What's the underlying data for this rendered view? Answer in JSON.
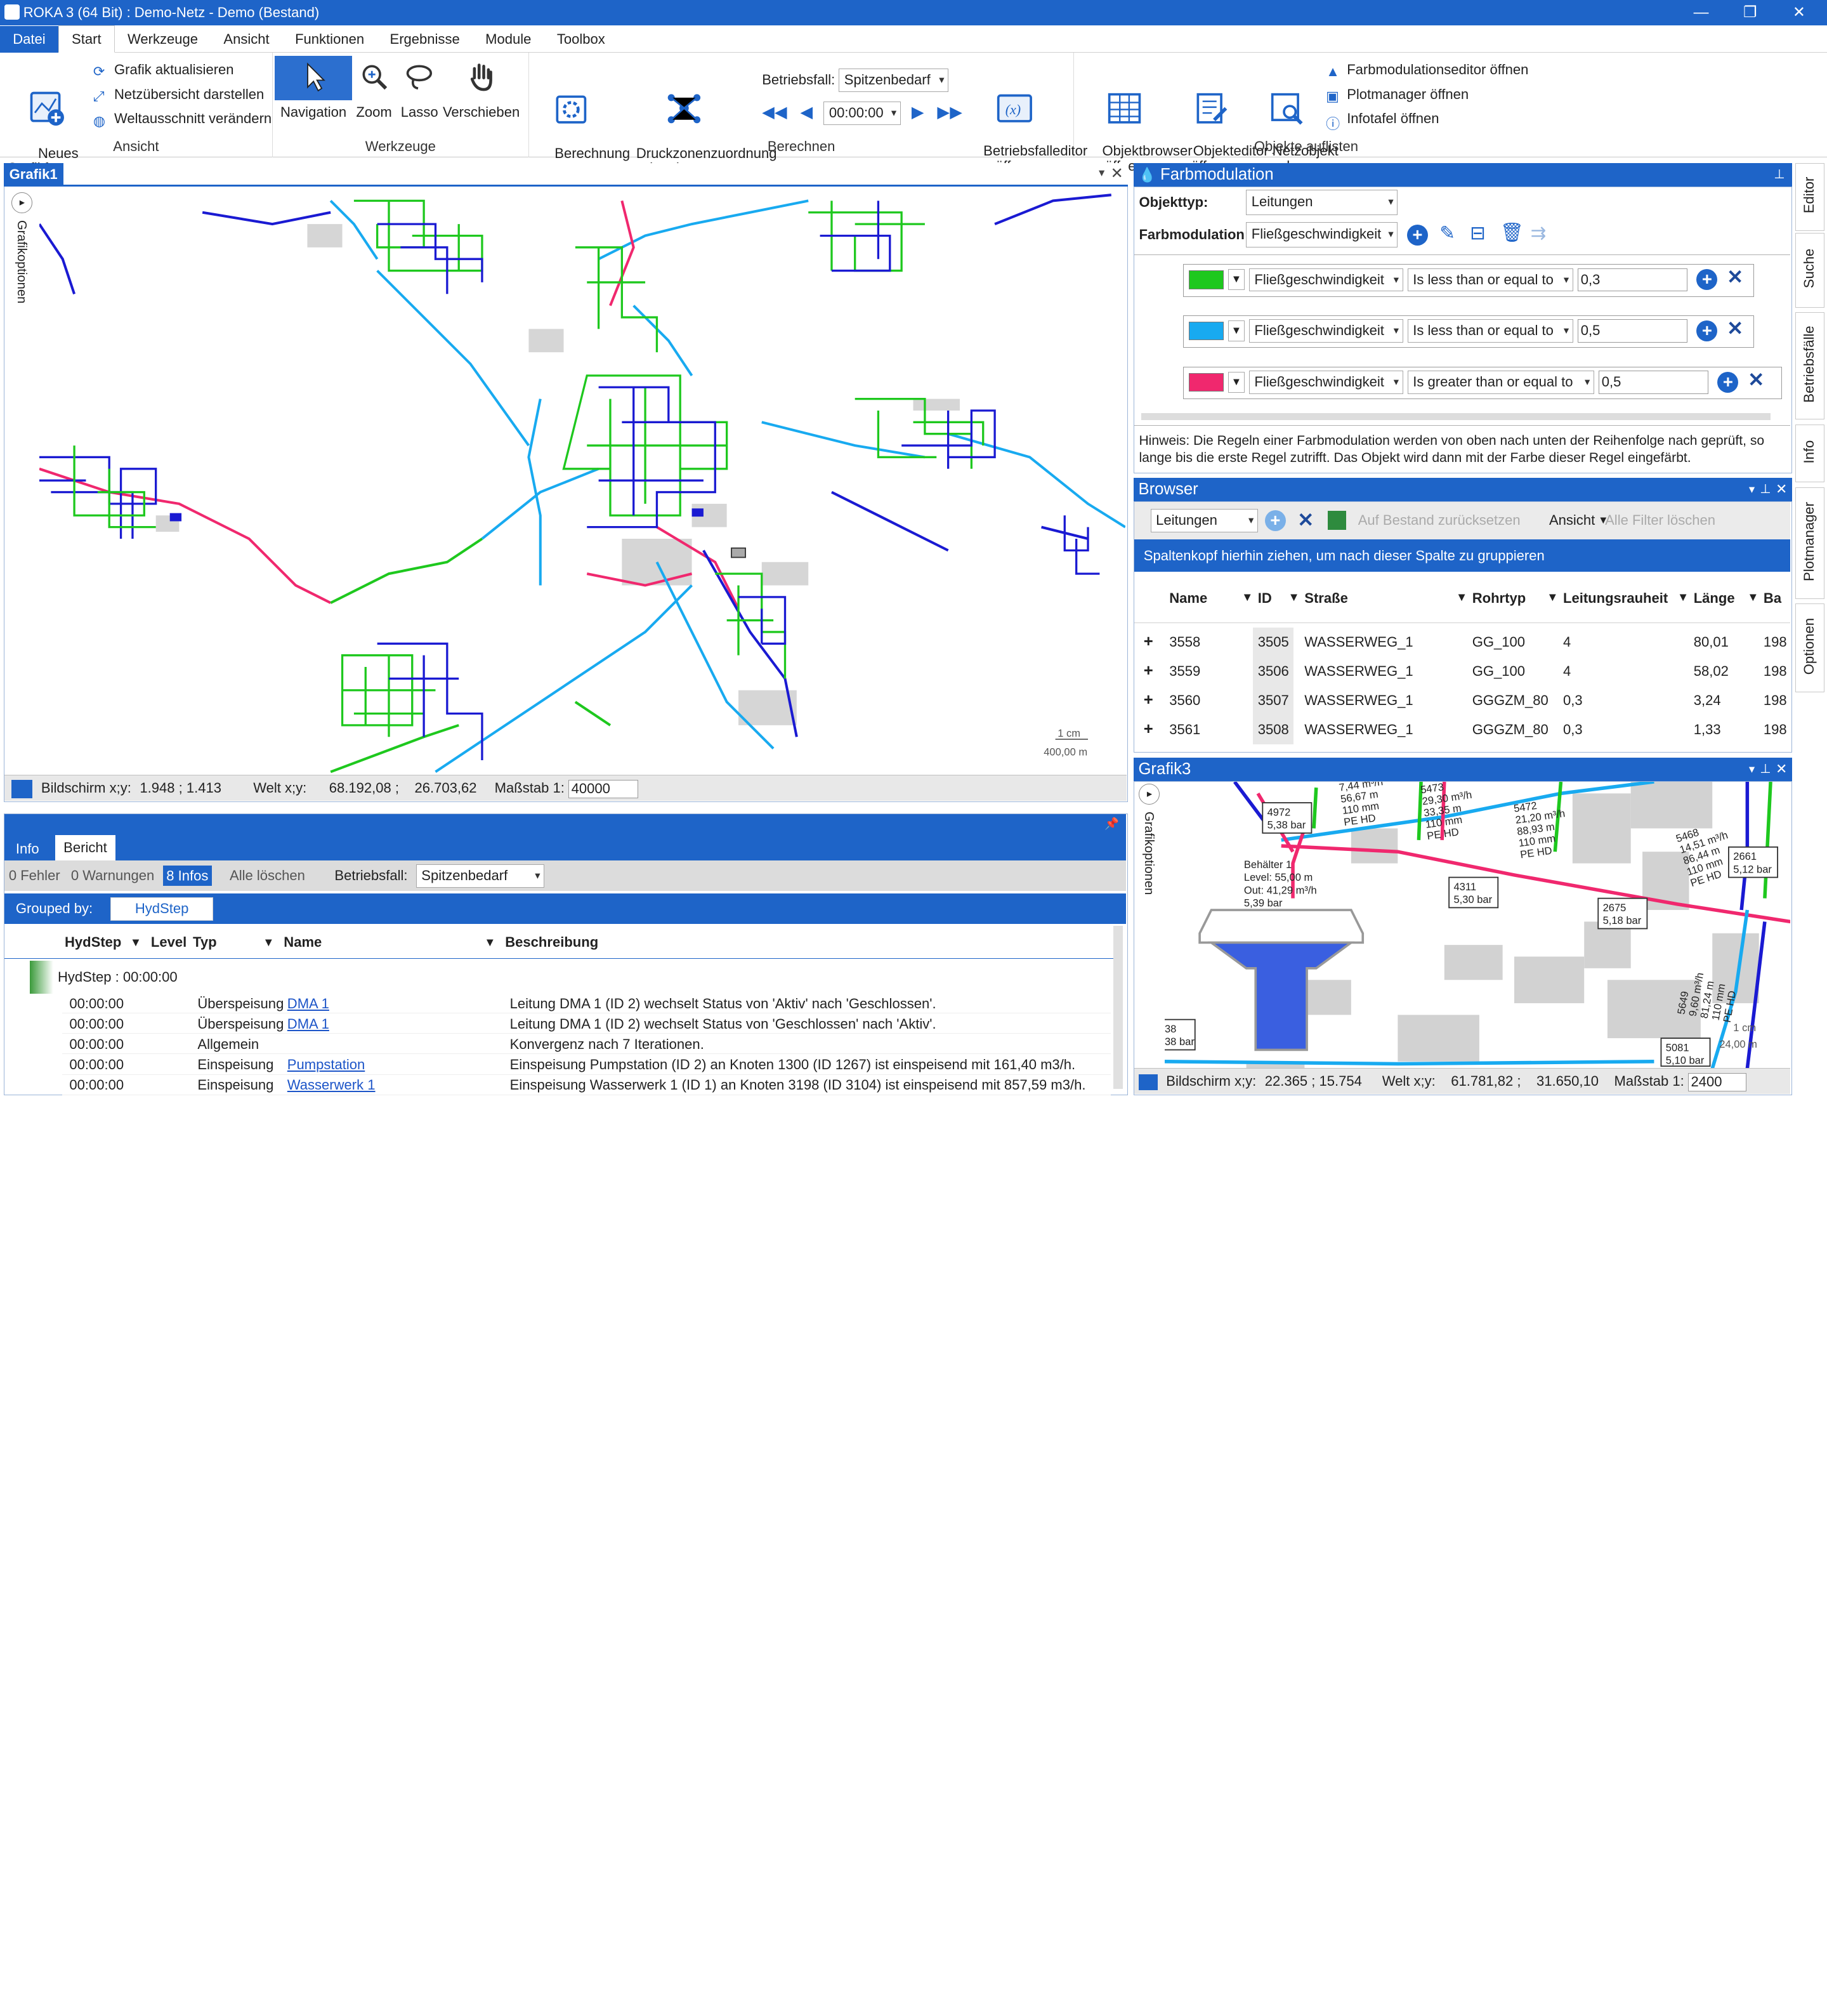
{
  "window": {
    "title": "ROKA 3 (64 Bit) : Demo-Netz - Demo (Bestand)",
    "min": "—",
    "max": "❐",
    "close": "✕"
  },
  "menu": [
    "Datei",
    "Start",
    "Werkzeuge",
    "Ansicht",
    "Funktionen",
    "Ergebnisse",
    "Module",
    "Toolbox"
  ],
  "ribbon": {
    "ansicht": {
      "label": "Ansicht",
      "neues": "Neues\nGrafikfenster",
      "items": [
        "Grafik aktualisieren",
        "Netzübersicht darstellen",
        "Weltausschnitt verändern"
      ]
    },
    "werkzeuge": {
      "label": "Werkzeuge",
      "items": [
        "Navigation",
        "Zoom",
        "Lasso",
        "Verschieben"
      ]
    },
    "berechnen": {
      "label": "Berechnen",
      "start": "Berechnung\nstarten",
      "druck": "Druckzonenzuordnung\nbestimmen",
      "betriebsfall_label": "Betriebsfall:",
      "betriebsfall_value": "Spitzenbedarf",
      "time": "00:00:00",
      "editor": "Betriebsfalleditor\nöffnen"
    },
    "objekte": {
      "label": "Objekte auflisten",
      "browser": "Objektbrowser\nöffnen",
      "editor": "Objekteditor\nöffnen",
      "netz": "Netzobjekt\nsuchen",
      "items": [
        "Farbmodulationseditor öffnen",
        "Plotmanager öffnen",
        "Infotafel öffnen"
      ]
    }
  },
  "grafik1": {
    "tab": "Grafik1",
    "options": "Grafikoptionen",
    "scale_cm": "1 cm",
    "scale_m": "400,00 m",
    "status": {
      "bildschirm_label": "Bildschirm x;y:",
      "bildschirm": "1.948 ; 1.413",
      "welt_label": "Welt x;y:",
      "welt_x": "68.192,08 ;",
      "welt_y": "26.703,62",
      "massstab_label": "Maßstab 1:",
      "massstab": "40000"
    }
  },
  "bottom": {
    "tabs": [
      "Info",
      "Bericht"
    ],
    "counts": [
      "0 Fehler",
      "0 Warnungen",
      "8 Infos",
      "Alle löschen"
    ],
    "betriebsfall_label": "Betriebsfall:",
    "betriebsfall": "Spitzenbedarf",
    "grouped_by": "Grouped by:",
    "group_chip": "HydStep",
    "columns": [
      "HydStep",
      "Level",
      "Typ",
      "Name",
      "Beschreibung"
    ],
    "group_row": "HydStep : 00:00:00",
    "rows": [
      {
        "t": "00:00:00",
        "typ": "Überspeisung",
        "name": "DMA 1",
        "desc": "Leitung DMA 1 (ID 2) wechselt Status von 'Aktiv' nach 'Geschlossen'."
      },
      {
        "t": "00:00:00",
        "typ": "Überspeisung",
        "name": "DMA 1",
        "desc": "Leitung DMA 1 (ID 2) wechselt Status von 'Geschlossen' nach 'Aktiv'."
      },
      {
        "t": "00:00:00",
        "typ": "Allgemein",
        "name": "",
        "desc": "Konvergenz nach 7 Iterationen."
      },
      {
        "t": "00:00:00",
        "typ": "Einspeisung",
        "name": "Pumpstation",
        "desc": "Einspeisung Pumpstation (ID 2) an Knoten 1300 (ID 1267) ist einspeisend mit 161,40 m3/h."
      },
      {
        "t": "00:00:00",
        "typ": "Einspeisung",
        "name": "Wasserwerk 1",
        "desc": "Einspeisung Wasserwerk 1 (ID 1) an Knoten 3198 (ID 3104) ist einspeisend mit 857,59 m3/h."
      }
    ]
  },
  "farb": {
    "title": "Farbmodulation",
    "objekttyp_label": "Objekttyp:",
    "objekttyp": "Leitungen",
    "farbmod_label": "Farbmodulation:",
    "farbmod": "Fließgeschwindigkeit",
    "rules": [
      {
        "color": "#1ec81e",
        "field": "Fließgeschwindigkeit",
        "op": "Is less than or equal to",
        "value": "0,3"
      },
      {
        "color": "#18aaf0",
        "field": "Fließgeschwindigkeit",
        "op": "Is less than or equal to",
        "value": "0,5"
      },
      {
        "color": "#f0286e",
        "field": "Fließgeschwindigkeit",
        "op": "Is greater than or equal to",
        "value": "0,5"
      }
    ],
    "hint": "Hinweis: Die Regeln einer Farbmodulation werden von oben nach unten der Reihenfolge nach geprüft, so lange bis die erste Regel zutrifft. Das Objekt wird dann mit der Farbe dieser Regel eingefärbt."
  },
  "browser": {
    "title": "Browser",
    "type": "Leitungen",
    "reset": "Auf Bestand zurücksetzen",
    "ansicht": "Ansicht",
    "filter": "Alle Filter löschen",
    "group_hint": "Spaltenkopf hierhin ziehen, um nach dieser Spalte zu gruppieren",
    "columns": [
      "Name",
      "ID",
      "Straße",
      "Rohrtyp",
      "Leitungsrauheit",
      "Länge",
      "Ba"
    ],
    "rows": [
      [
        "3558",
        "3505",
        "WASSERWEG_1",
        "GG_100",
        "4",
        "80,01",
        "198"
      ],
      [
        "3559",
        "3506",
        "WASSERWEG_1",
        "GG_100",
        "4",
        "58,02",
        "198"
      ],
      [
        "3560",
        "3507",
        "WASSERWEG_1",
        "GGGZM_80",
        "0,3",
        "3,24",
        "198"
      ],
      [
        "3561",
        "3508",
        "WASSERWEG_1",
        "GGGZM_80",
        "0,3",
        "1,33",
        "198"
      ]
    ]
  },
  "grafik3": {
    "title": "Grafik3",
    "options": "Grafikoptionen",
    "labels": {
      "n4972": "4972\n5,38 bar",
      "behaelter": "Behälter 1\nLevel: 55,00 m\nOut: 41,29 m³/h\n5,39 bar",
      "n4311": "4311\n5,30 bar",
      "n2675": "2675\n5,18 bar",
      "n2661": "2661\n5,12 bar",
      "n5081": "5081\n5,10 bar",
      "n38": "38\n38 bar",
      "p5473": "5473\n29,30 m³/h\n33,35 m\n110 mm\nPE HD",
      "p5472": "5472\n21,20 m³/h\n88,93 m\n110 mm\nPE HD",
      "p5468": "5468\n14,51 m³/h\n86,44 m\n110 mm\nPE HD",
      "pleft": "7,44 m³/h\n56,67 m\n110 mm\nPE HD",
      "p5649": "5649\n9,60 m³/h\n81,24 m\n110 mm\nPE HD",
      "scale_cm": "1 cm",
      "scale_m": "24,00 m"
    },
    "status": {
      "bildschirm_label": "Bildschirm x;y:",
      "bildschirm": "22.365 ; 15.754",
      "welt_label": "Welt x;y:",
      "welt_x": "61.781,82 ;",
      "welt_y": "31.650,10",
      "massstab_label": "Maßstab 1:",
      "massstab": "2400"
    }
  },
  "sidetabs": [
    "Editor",
    "Suche",
    "Betriebsfälle",
    "Info",
    "Plotmanager",
    "Optionen"
  ],
  "colors": {
    "accent": "#1e64c8",
    "low": "#1ec81e",
    "mid": "#18aaf0",
    "high": "#f0286e",
    "dark": "#1a1ad2"
  }
}
